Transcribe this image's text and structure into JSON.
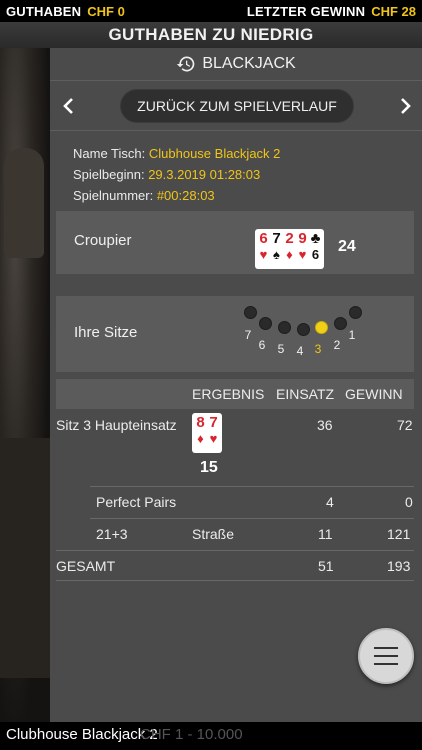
{
  "topbar": {
    "balance_label": "GUTHABEN",
    "balance_value": "CHF 0",
    "last_win_label": "LETZTER GEWINN",
    "last_win_value": "CHF 28"
  },
  "title": "GUTHABEN ZU NIEDRIG",
  "history": {
    "header": "BLACKJACK",
    "back_button": "ZURÜCK ZUM SPIELVERLAUF",
    "table_name_label": "Name Tisch:",
    "table_name_value": "Clubhouse Blackjack 2",
    "start_label": "Spielbeginn:",
    "start_value": "29.3.2019 01:28:03",
    "game_no_label": "Spielnummer:",
    "game_no_value": "#00:28:03"
  },
  "croupier": {
    "label": "Croupier",
    "cards": [
      {
        "rank": "6",
        "suit": "♥",
        "color": "#d9262e"
      },
      {
        "rank": "7",
        "suit": "♠",
        "color": "#111111"
      },
      {
        "rank": "2",
        "suit": "♦",
        "color": "#d9262e"
      },
      {
        "rank": "9",
        "suit": "♥",
        "color": "#d9262e"
      },
      {
        "rank": "♣",
        "suit": "6",
        "color": "#111111"
      }
    ],
    "total": "24"
  },
  "seats": {
    "label": "Ihre Sitze",
    "numbers": [
      "7",
      "6",
      "5",
      "4",
      "3",
      "2",
      "1"
    ],
    "active": "3"
  },
  "results": {
    "col_result": "ERGEBNIS",
    "col_bet": "EINSATZ",
    "col_win": "GEWINN",
    "main_label": "Sitz 3 Haupteinsatz",
    "main_cards": [
      {
        "rank": "8",
        "suit": "♦",
        "color": "#d9262e"
      },
      {
        "rank": "7",
        "suit": "♥",
        "color": "#d9262e"
      }
    ],
    "main_card_bottom": "◆ᒣ",
    "main_total": "15",
    "main_bet": "36",
    "main_win": "72",
    "pp_label": "Perfect Pairs",
    "pp_bet": "4",
    "pp_win": "0",
    "side_label": "21+3",
    "side_result": "Straße",
    "side_bet": "11",
    "side_win": "121",
    "total_label": "GESAMT",
    "total_bet": "51",
    "total_win": "193"
  },
  "footer": {
    "text": "Clubhouse Blackjack 2",
    "ghost": "CHF 1 - 10.000"
  }
}
